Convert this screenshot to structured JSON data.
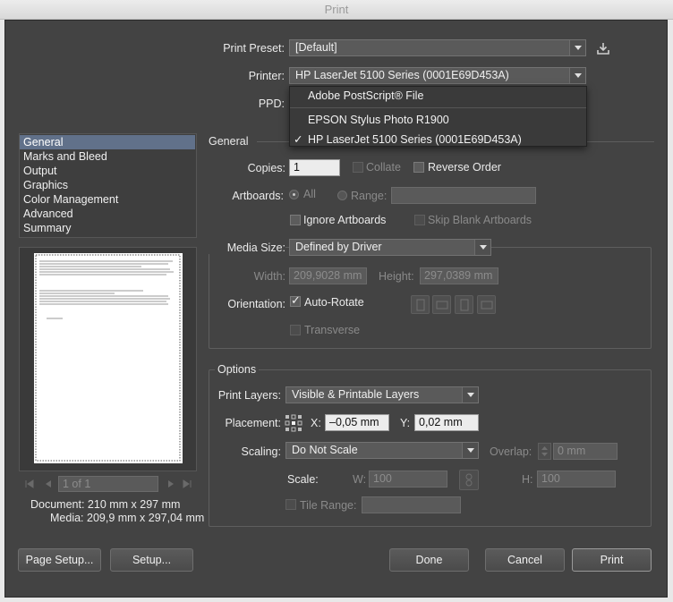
{
  "window": {
    "title": "Print"
  },
  "header": {
    "print_preset_label": "Print Preset:",
    "print_preset_value": "[Default]",
    "printer_label": "Printer:",
    "printer_value": "HP LaserJet 5100 Series (0001E69D453A)",
    "ppd_label": "PPD:"
  },
  "printer_menu": {
    "items": [
      {
        "label": "Adobe PostScript® File",
        "checked": false
      },
      {
        "label": "EPSON Stylus Photo R1900",
        "checked": false
      },
      {
        "label": "HP LaserJet 5100 Series (0001E69D453A)",
        "checked": true
      }
    ],
    "check_mark": "✓"
  },
  "sidebar": {
    "items": [
      {
        "label": "General",
        "selected": true
      },
      {
        "label": "Marks and Bleed"
      },
      {
        "label": "Output"
      },
      {
        "label": "Graphics"
      },
      {
        "label": "Color Management"
      },
      {
        "label": "Advanced"
      },
      {
        "label": "Summary"
      }
    ]
  },
  "preview": {
    "page_field": "1 of 1",
    "document_info": "Document: 210 mm x 297 mm",
    "media_info": "Media: 209,9 mm x 297,04 mm"
  },
  "general": {
    "section_title": "General",
    "copies_label": "Copies:",
    "copies_value": "1",
    "collate_label": "Collate",
    "reverse_order_label": "Reverse Order",
    "artboards_label": "Artboards:",
    "all_label": "All",
    "range_label": "Range:",
    "ignore_artboards_label": "Ignore Artboards",
    "skip_blank_label": "Skip Blank Artboards"
  },
  "media": {
    "media_size_label": "Media Size:",
    "media_size_value": "Defined by Driver",
    "width_label": "Width:",
    "width_value": "209,9028 mm",
    "height_label": "Height:",
    "height_value": "297,0389 mm",
    "orientation_label": "Orientation:",
    "auto_rotate_label": "Auto-Rotate",
    "transverse_label": "Transverse"
  },
  "options": {
    "section_title": "Options",
    "print_layers_label": "Print Layers:",
    "print_layers_value": "Visible & Printable Layers",
    "placement_label": "Placement:",
    "x_label": "X:",
    "x_value": "–0,05 mm",
    "y_label": "Y:",
    "y_value": "0,02 mm",
    "scaling_label": "Scaling:",
    "scaling_value": "Do Not Scale",
    "overlap_label": "Overlap:",
    "overlap_value": "0 mm",
    "scale_label": "Scale:",
    "w_label": "W:",
    "w_value": "100",
    "h_label": "H:",
    "h_value": "100",
    "tile_range_label": "Tile Range:"
  },
  "buttons": {
    "page_setup": "Page Setup...",
    "setup": "Setup...",
    "done": "Done",
    "cancel": "Cancel",
    "print": "Print"
  },
  "colors": {
    "dialog_bg": "#434343",
    "selection": "#61718a",
    "menu_bg": "#3a3a3a"
  }
}
